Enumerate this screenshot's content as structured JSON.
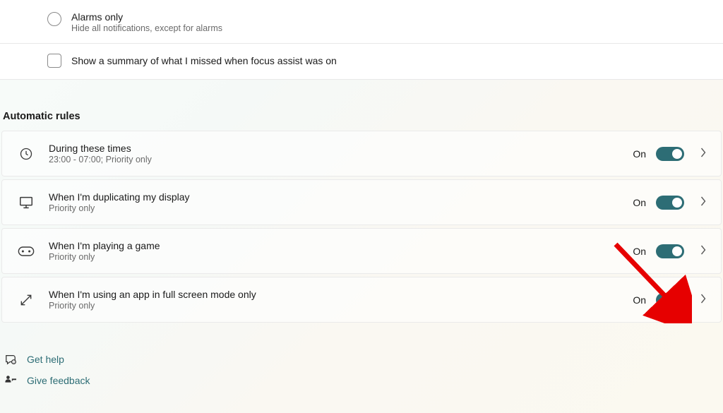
{
  "priority_option": {
    "title": "Alarms only",
    "subtitle": "Hide all notifications, except for alarms"
  },
  "summary_checkbox": {
    "label": "Show a summary of what I missed when focus assist was on"
  },
  "section_title": "Automatic rules",
  "rules": [
    {
      "title": "During these times",
      "subtitle": "23:00 - 07:00; Priority only",
      "state": "On"
    },
    {
      "title": "When I'm duplicating my display",
      "subtitle": "Priority only",
      "state": "On"
    },
    {
      "title": "When I'm playing a game",
      "subtitle": "Priority only",
      "state": "On"
    },
    {
      "title": "When I'm using an app in full screen mode only",
      "subtitle": "Priority only",
      "state": "On"
    }
  ],
  "links": {
    "help": "Get help",
    "feedback": "Give feedback"
  }
}
